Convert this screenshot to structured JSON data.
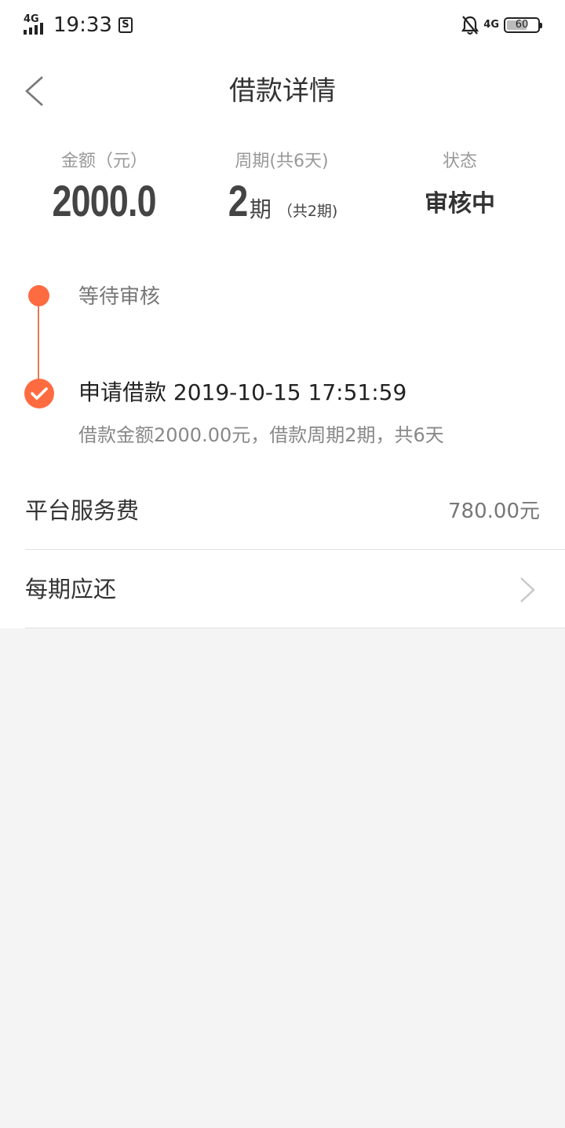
{
  "status_bar": {
    "network_left": "4G",
    "time": "19:33",
    "s_icon": "S",
    "network_right": "4G",
    "battery": "60"
  },
  "nav": {
    "title": "借款详情"
  },
  "summary": {
    "amount_label": "金额（元）",
    "amount_value": "2000.0",
    "period_label": "周期(共6天)",
    "period_value": "2",
    "period_unit": "期",
    "period_sub": "（共2期)",
    "status_label": "状态",
    "status_value": "审核中"
  },
  "timeline": {
    "step1": "等待审核",
    "step2": "申请借款 2019-10-15 17:51:59",
    "step2_detail": "借款金额2000.00元，借款周期2期，共6天"
  },
  "rows": {
    "service_fee_label": "平台服务费",
    "service_fee_value": "780.00元",
    "per_period_label": "每期应还"
  },
  "colors": {
    "accent": "#ff6b40",
    "background": "#f4f4f4"
  },
  "icons": {
    "back": "chevron-left-icon",
    "check": "check-icon",
    "row_arrow": "chevron-right-icon",
    "bell_off": "bell-off-icon"
  }
}
